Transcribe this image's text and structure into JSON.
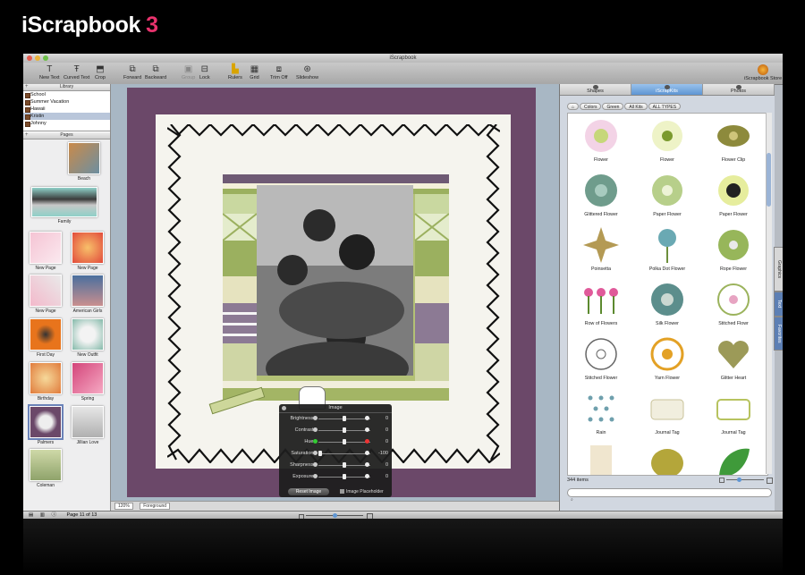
{
  "brand": {
    "name": "iScrapbook",
    "version": "3"
  },
  "window": {
    "title": "iScrapbook"
  },
  "toolbar": {
    "new_text": "New Text",
    "curved_text": "Curved Text",
    "crop": "Crop",
    "forward": "Forward",
    "backward": "Backward",
    "group": "Group",
    "lock": "Lock",
    "rulers": "Rulers",
    "grid": "Grid",
    "trim_off": "Trim Off",
    "slideshow": "Slideshow",
    "store": "iScrapbook Store"
  },
  "library": {
    "title": "Library",
    "items": [
      "School",
      "Summer Vacation",
      "Hawaii",
      "Kristin",
      "Johnny"
    ],
    "selected": "Kristin"
  },
  "pages": {
    "title": "Pages",
    "items": [
      "Beach",
      "Family",
      "New Page",
      "New Page",
      "New Page",
      "American Girls",
      "First Day",
      "New Outfit",
      "Birthday",
      "Spring",
      "Palmers",
      "Jillian Love",
      "Coleman"
    ],
    "selected": "Palmers"
  },
  "status": {
    "zoom": "120%",
    "layer": "Foreground",
    "page_info": "Page 11 of 13"
  },
  "image_hud": {
    "title": "Image",
    "rows": [
      {
        "label": "Brightness:",
        "value": "0",
        "level": 0.5
      },
      {
        "label": "Contrast:",
        "value": "0",
        "level": 0.5
      },
      {
        "label": "Hue:",
        "value": "0",
        "level": 0.5
      },
      {
        "label": "Saturation:",
        "value": "-100",
        "level": 0.0
      },
      {
        "label": "Sharpness:",
        "value": "0",
        "level": 0.5
      },
      {
        "label": "Exposure:",
        "value": "0",
        "level": 0.5
      }
    ],
    "reset_label": "Reset Image",
    "placeholder_label": "Image Placeholder"
  },
  "browser": {
    "tabs": [
      "Shapes",
      "iScrapKits",
      "Photos"
    ],
    "active_tab": "iScrapKits",
    "breadcrumbs": [
      "Colors",
      "Green",
      "All Kits",
      "ALL TYPES"
    ],
    "items": [
      "Flower",
      "Flower",
      "Flower Clip",
      "Glittered Flower",
      "Paper Flower",
      "Paper Flower",
      "Poinsetta",
      "Polka Dot Flower",
      "Rope Flower",
      "Row of Flowers",
      "Silk Flower",
      "Stitched Flowr",
      "Stitched Flower",
      "Yarn Flower",
      "Glitter Heart",
      "Rain",
      "Journal Tag",
      "Journal Tag",
      "",
      "",
      ""
    ],
    "count": "344 items",
    "side_tabs": [
      "Graphics",
      "Text",
      "Favorites"
    ],
    "active_side_tab": "Text"
  },
  "colors": {
    "purple_paper": "#6b4869",
    "accent_blue": "#5e95d3",
    "brand_pink": "#e8336d"
  }
}
